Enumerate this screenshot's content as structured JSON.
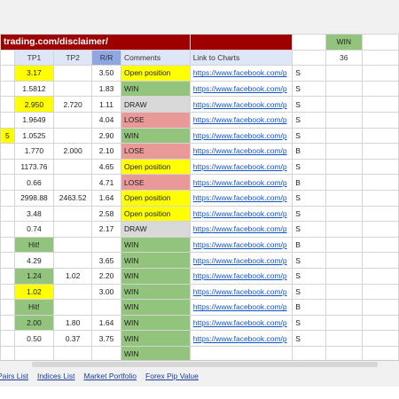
{
  "sheet": {
    "title": "trading.com/disclaimer/",
    "headers": {
      "tp1": "TP1",
      "tp2": "TP2",
      "rr": "R/R",
      "comments": "Comments",
      "link": "Link to Charts"
    },
    "summary": {
      "label": "WIN",
      "value": "36"
    },
    "rows": [
      {
        "a": "",
        "tp1": "3.17",
        "tp2": "",
        "rr": "3.50",
        "comment": "Open position",
        "status": "open",
        "link": "https://www.facebook.com/p",
        "tail": "S"
      },
      {
        "a": "",
        "tp1": "1.5812",
        "tp2": "",
        "rr": "1.83",
        "comment": "WIN",
        "status": "win",
        "link": "https://www.facebook.com/p",
        "tail": "S"
      },
      {
        "a": "",
        "tp1": "2.950",
        "tp2": "2.720",
        "rr": "1.11",
        "comment": "DRAW",
        "status": "draw",
        "link": "https://www.facebook.com/p",
        "tail": "S"
      },
      {
        "a": "",
        "tp1": "1.9649",
        "tp2": "",
        "rr": "4.04",
        "comment": "LOSE",
        "status": "lose",
        "link": "https://www.facebook.com/p",
        "tail": "S"
      },
      {
        "a": "5",
        "tp1": "1.0525",
        "tp2": "",
        "rr": "2.90",
        "comment": "WIN",
        "status": "win",
        "link": "https://www.facebook.com/p",
        "tail": "S"
      },
      {
        "a": "",
        "tp1": "1.770",
        "tp2": "2.000",
        "rr": "2.10",
        "comment": "LOSE",
        "status": "lose",
        "link": "https://www.facebook.com/p",
        "tail": "B"
      },
      {
        "a": "",
        "tp1": "1173.76",
        "tp2": "",
        "rr": "4.65",
        "comment": "Open position",
        "status": "open",
        "link": "https://www.facebook.com/p",
        "tail": "S"
      },
      {
        "a": "",
        "tp1": "0.66",
        "tp2": "",
        "rr": "4.71",
        "comment": "LOSE",
        "status": "lose",
        "link": "https://www.facebook.com/p",
        "tail": "B"
      },
      {
        "a": "",
        "tp1": "2998.88",
        "tp2": "2463.52",
        "rr": "1.64",
        "comment": "Open position",
        "status": "open",
        "link": "https://www.facebook.com/p",
        "tail": "S"
      },
      {
        "a": "",
        "tp1": "3.48",
        "tp2": "",
        "rr": "2.58",
        "comment": "Open position",
        "status": "open",
        "link": "https://www.facebook.com/p",
        "tail": "S"
      },
      {
        "a": "",
        "tp1": "0.74",
        "tp2": "",
        "rr": "2.17",
        "comment": "DRAW",
        "status": "draw",
        "link": "https://www.facebook.com/p",
        "tail": "S"
      },
      {
        "a": "",
        "tp1": "Hit!",
        "tp2": "",
        "rr": "",
        "comment": "WIN",
        "status": "win",
        "tp1hit": true,
        "link": "https://www.facebook.com/p",
        "tail": "B"
      },
      {
        "a": "",
        "tp1": "4.29",
        "tp2": "",
        "rr": "3.65",
        "comment": "WIN",
        "status": "win",
        "link": "https://www.facebook.com/p",
        "tail": "S"
      },
      {
        "a": "",
        "tp1": "1.24",
        "tp2": "1.02",
        "rr": "2.20",
        "comment": "WIN",
        "status": "win",
        "tp1hit": true,
        "link": "https://www.facebook.com/p",
        "tail": "S"
      },
      {
        "a": "",
        "tp1": "1.02",
        "tp2": "",
        "rr": "3.00",
        "comment": "WIN",
        "status": "win",
        "tp1yellow": true,
        "link": "https://www.facebook.com/p",
        "tail": "S"
      },
      {
        "a": "",
        "tp1": "Hit!",
        "tp2": "",
        "rr": "",
        "comment": "WIN",
        "status": "win",
        "tp1hit": true,
        "link": "https://www.facebook.com/p",
        "tail": "B"
      },
      {
        "a": "",
        "tp1": "2.00",
        "tp2": "1.80",
        "rr": "1.64",
        "comment": "WIN",
        "status": "win",
        "tp1hit": true,
        "link": "https://www.facebook.com/p",
        "tail": "S"
      },
      {
        "a": "",
        "tp1": "0.50",
        "tp2": "0.37",
        "rr": "3.75",
        "comment": "WIN",
        "status": "win",
        "link": "https://www.facebook.com/p",
        "tail": "S"
      },
      {
        "a": "",
        "tp1": "",
        "tp2": "",
        "rr": "",
        "comment": "WIN",
        "status": "win",
        "link": "",
        "tail": ""
      }
    ]
  },
  "tabs": [
    "Pairs List",
    "Indices List",
    "Market Portfolio",
    "Forex Pip Value"
  ],
  "colors": {
    "title_bg": "#9e0000",
    "win": "#93c47d",
    "lose": "#ea9999",
    "draw": "#d9d9d9",
    "open": "#ffff00",
    "header": "#dfe6f7",
    "rr_header": "#8fa6e3",
    "link": "#1155cc"
  }
}
